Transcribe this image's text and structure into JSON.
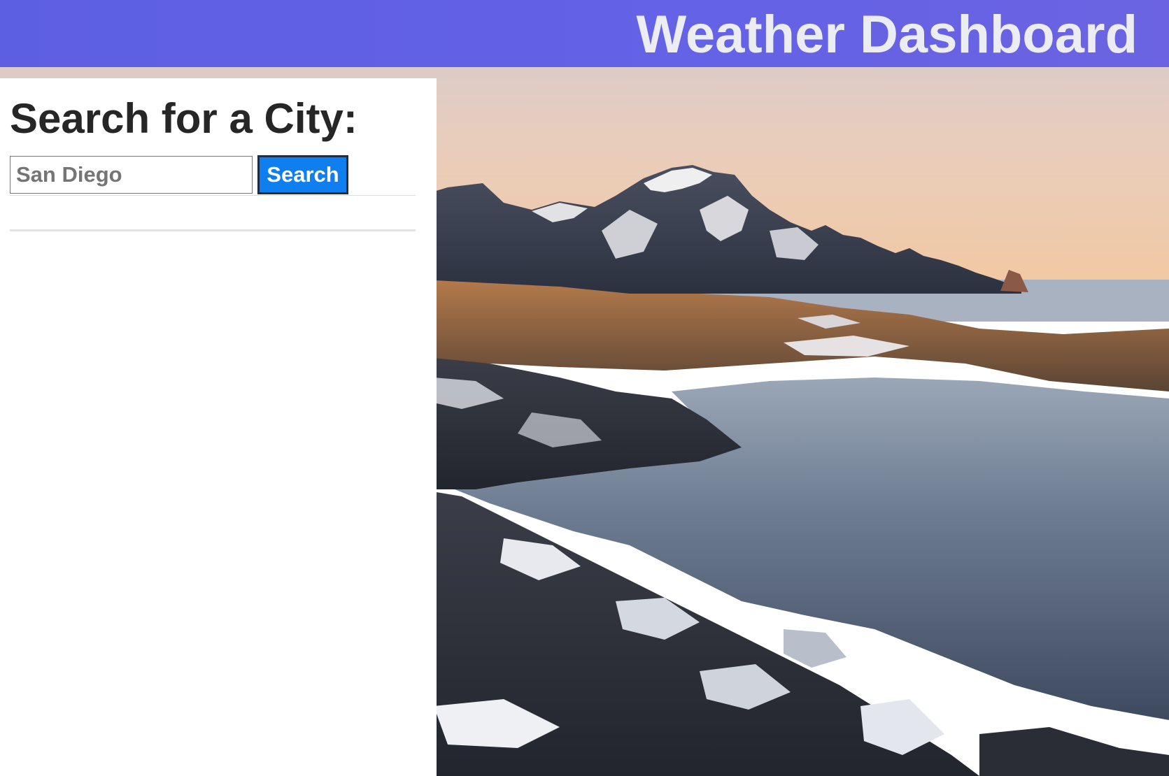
{
  "header": {
    "title": "Weather Dashboard"
  },
  "search": {
    "heading": "Search for a City:",
    "input_value": "San Diego",
    "button_label": "Search"
  },
  "search_history": {
    "items": []
  },
  "background": {
    "subject": "snow-capped mountains above a rocky coastline at sunset"
  },
  "colors": {
    "header_bg": "#6462e6",
    "header_text": "#ececf3",
    "button_bg": "#0f7ff0",
    "heading_text": "#262626"
  }
}
